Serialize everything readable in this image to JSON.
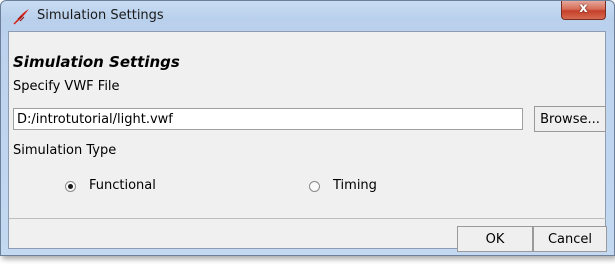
{
  "window": {
    "title": "Simulation Settings",
    "icon": "tk-feather-icon",
    "close_glyph": "x"
  },
  "form": {
    "heading": "Simulation Settings",
    "file_label": "Specify VWF File",
    "file_value": "D:/introtutorial/light.vwf",
    "browse_label": "Browse...",
    "type_label": "Simulation Type",
    "options": [
      {
        "label": "Functional",
        "selected": true
      },
      {
        "label": "Timing",
        "selected": false
      }
    ]
  },
  "buttons": {
    "ok_label": "OK",
    "cancel_label": "Cancel"
  },
  "colors": {
    "close_button": "#c6402a",
    "title_bar": "#b9d0ec",
    "client_bg": "#f0f0f0"
  }
}
